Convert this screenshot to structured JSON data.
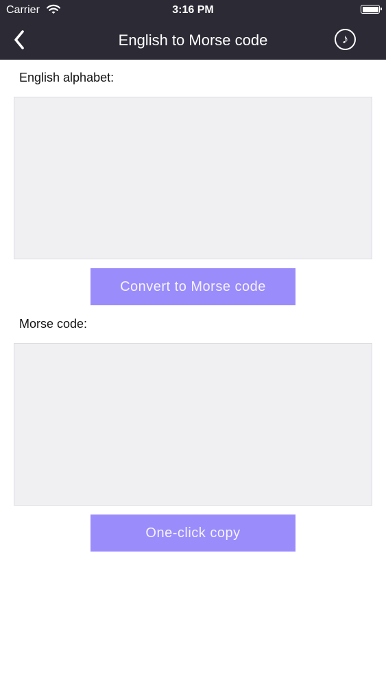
{
  "status_bar": {
    "carrier": "Carrier",
    "time": "3:16 PM",
    "wifi_icon": "wifi-icon",
    "battery_icon": "battery-icon"
  },
  "nav": {
    "title": "English to Morse code",
    "back_icon": "chevron-left-icon",
    "music_icon": "music-note-icon",
    "music_glyph": "♪"
  },
  "input_section": {
    "label": "English alphabet:",
    "value": "",
    "button_label": "Convert to Morse code"
  },
  "output_section": {
    "label": "Morse code:",
    "value": "",
    "button_label": "One-click copy"
  },
  "colors": {
    "header_background": "#2b2a35",
    "button_background": "#9a8cfa",
    "textarea_background": "#f0f0f3"
  }
}
